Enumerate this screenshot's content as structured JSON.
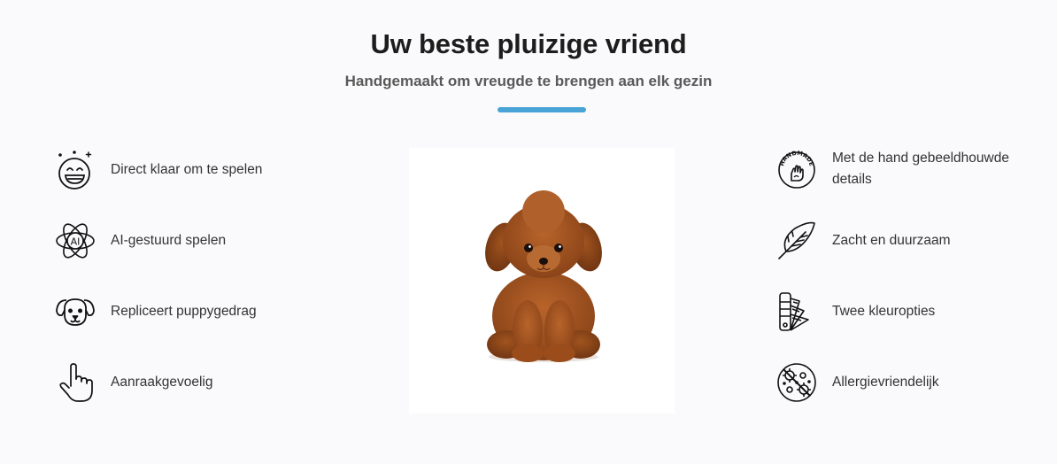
{
  "header": {
    "title": "Uw beste pluizige vriend",
    "subtitle": "Handgemaakt om vreugde te brengen aan elk gezin",
    "accent_color": "#4aa3d6"
  },
  "features_left": [
    {
      "icon": "smiley-sparkle-icon",
      "label": "Direct klaar om te spelen"
    },
    {
      "icon": "ai-atom-icon",
      "label": "AI-gestuurd spelen"
    },
    {
      "icon": "dog-face-icon",
      "label": "Repliceert puppygedrag"
    },
    {
      "icon": "pointing-hand-icon",
      "label": "Aanraakgevoelig"
    }
  ],
  "features_right": [
    {
      "icon": "handmade-badge-icon",
      "label": "Met de hand gebeeldhouwde details",
      "badge_text": "HANDMADE"
    },
    {
      "icon": "feather-icon",
      "label": "Zacht en duurzaam"
    },
    {
      "icon": "color-swatch-icon",
      "label": "Twee kleuropties"
    },
    {
      "icon": "allergy-free-icon",
      "label": "Allergievriendelijk"
    }
  ],
  "product": {
    "image": "plush-poodle-puppy",
    "fur_color": "#a0521e"
  }
}
